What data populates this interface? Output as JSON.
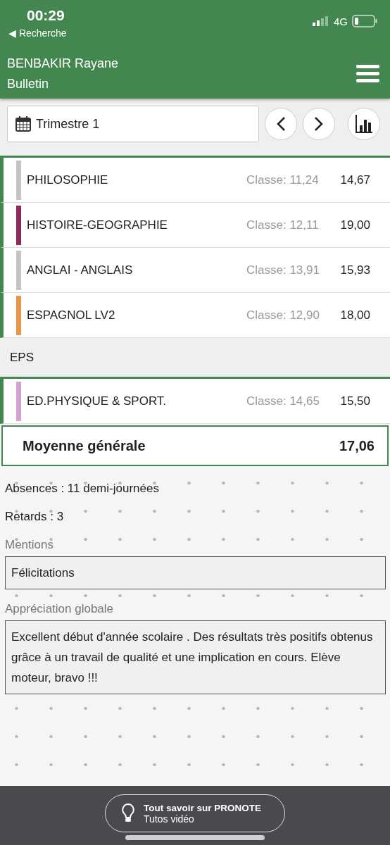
{
  "status_bar": {
    "time": "00:29",
    "back_label": "◀ Recherche",
    "network": "4G"
  },
  "header": {
    "student": "BENBAKIR Rayane",
    "page": "Bulletin"
  },
  "toolbar": {
    "period": "Trimestre 1"
  },
  "groups": [
    {
      "subjects": [
        {
          "name": "PHILOSOPHIE",
          "class_avg": "Classe: 11,24",
          "grade": "14,67",
          "color": "#c4c4c4"
        },
        {
          "name": "HISTOIRE-GEOGRAPHIE",
          "class_avg": "Classe: 12,11",
          "grade": "19,00",
          "color": "#8c2a5c"
        },
        {
          "name": "ANGLAI - ANGLAIS",
          "class_avg": "Classe: 13,91",
          "grade": "15,93",
          "color": "#c4c4c4"
        },
        {
          "name": "ESPAGNOL LV2",
          "class_avg": "Classe: 12,90",
          "grade": "18,00",
          "color": "#e8964a"
        }
      ]
    },
    {
      "title": "EPS",
      "subjects": [
        {
          "name": "ED.PHYSIQUE & SPORT.",
          "class_avg": "Classe: 14,65",
          "grade": "15,50",
          "color": "#d4a2cf"
        }
      ]
    }
  ],
  "overall": {
    "label": "Moyenne générale",
    "grade": "17,06"
  },
  "absences": "Absences : 11 demi-journées",
  "lates": "Retards : 3",
  "mentions": {
    "label": "Mentions",
    "value": "Félicitations"
  },
  "appreciation": {
    "label": "Appréciation globale",
    "value": "Excellent début d'année scolaire . Des résultats très positifs obtenus grâce à un travail de qualité et une implication en cours. Elève moteur, bravo !!!"
  },
  "footer": {
    "title": "Tout savoir sur PRONOTE",
    "subtitle": "Tutos vidéo"
  }
}
